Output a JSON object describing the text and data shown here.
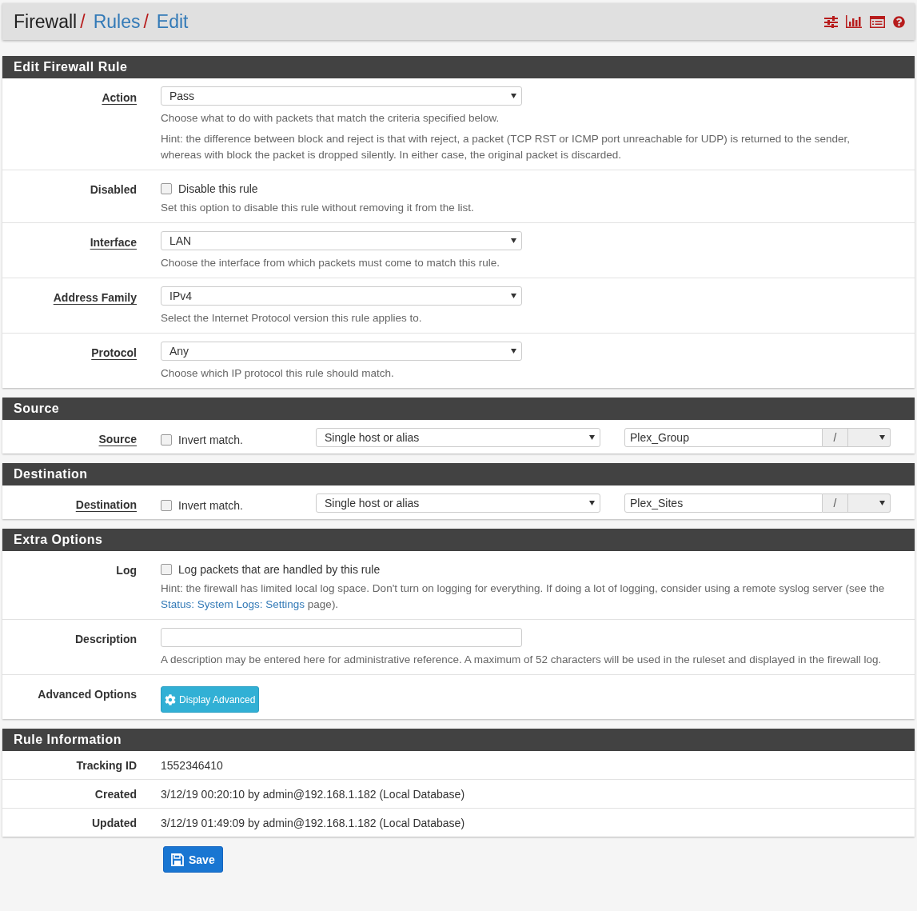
{
  "breadcrumb": [
    {
      "label": "Firewall",
      "link": false,
      "separator": "/"
    },
    {
      "label": "Rules",
      "link": true,
      "separator": "/"
    },
    {
      "label": "Edit",
      "link": true
    }
  ],
  "panels": [
    {
      "title": "Edit Firewall Rule",
      "rows": [
        {
          "kind": "select",
          "label": "Action",
          "required": true,
          "value": "Pass",
          "help": [
            [
              {
                "text": "Choose what to do with packets that match the criteria specified below.",
                "link": false
              }
            ],
            [
              {
                "text": "Hint: the difference between block and reject is that with reject, a packet (TCP RST or ICMP port unreachable for UDP) is returned to the sender, whereas with block the packet is dropped silently. In either case, the original packet is discarded.",
                "link": false
              }
            ]
          ]
        },
        {
          "kind": "checkbox",
          "label": "Disabled",
          "required": false,
          "checked": false,
          "text": "Disable this rule",
          "help": [
            [
              {
                "text": "Set this option to disable this rule without removing it from the list.",
                "link": false
              }
            ]
          ]
        },
        {
          "kind": "select",
          "label": "Interface",
          "required": true,
          "value": "LAN",
          "help": [
            [
              {
                "text": "Choose the interface from which packets must come to match this rule.",
                "link": false
              }
            ]
          ]
        },
        {
          "kind": "select",
          "label": "Address Family",
          "required": true,
          "value": "IPv4",
          "help": [
            [
              {
                "text": "Select the Internet Protocol version this rule applies to.",
                "link": false
              }
            ]
          ]
        },
        {
          "kind": "select",
          "label": "Protocol",
          "required": true,
          "value": "Any",
          "help": [
            [
              {
                "text": "Choose which IP protocol this rule should match.",
                "link": false
              }
            ]
          ]
        }
      ]
    },
    {
      "title": "Source",
      "rows": [
        {
          "kind": "address",
          "label": "Source",
          "required": true,
          "checked": false,
          "text": "Invert match.",
          "type": "Single host or alias",
          "address": "Plex_Group",
          "separator": "/"
        }
      ]
    },
    {
      "title": "Destination",
      "rows": [
        {
          "kind": "address",
          "label": "Destination",
          "required": true,
          "checked": false,
          "text": "Invert match.",
          "type": "Single host or alias",
          "address": "Plex_Sites",
          "separator": "/"
        }
      ]
    },
    {
      "title": "Extra Options",
      "rows": [
        {
          "kind": "checkbox",
          "label": "Log",
          "required": false,
          "checked": false,
          "text": "Log packets that are handled by this rule",
          "help": [
            [
              {
                "text": "Hint: the firewall has limited local log space. Don't turn on logging for everything. If doing a lot of logging, consider using a remote syslog server (see the ",
                "link": false
              },
              {
                "text": "Status: System Logs: Settings",
                "link": true
              },
              {
                "text": " page).",
                "link": false
              }
            ]
          ]
        },
        {
          "kind": "input",
          "label": "Description",
          "required": false,
          "help": [
            [
              {
                "text": "A description may be entered here for administrative reference. A maximum of 52 characters will be used in the ruleset and displayed in the firewall log.",
                "link": false
              }
            ]
          ]
        },
        {
          "kind": "button",
          "label": "Advanced Options",
          "required": false,
          "button": "Display Advanced"
        }
      ]
    },
    {
      "title": "Rule Information",
      "rows": [
        {
          "kind": "info",
          "label": "Tracking ID",
          "required": false,
          "value": "1552346410"
        },
        {
          "kind": "info",
          "label": "Created",
          "required": false,
          "value": "3/12/19 00:20:10 by admin@192.168.1.182 (Local Database)"
        },
        {
          "kind": "info",
          "label": "Updated",
          "required": false,
          "value": "3/12/19 01:49:09 by admin@192.168.1.182 (Local Database)"
        }
      ]
    }
  ],
  "save_button": "Save"
}
